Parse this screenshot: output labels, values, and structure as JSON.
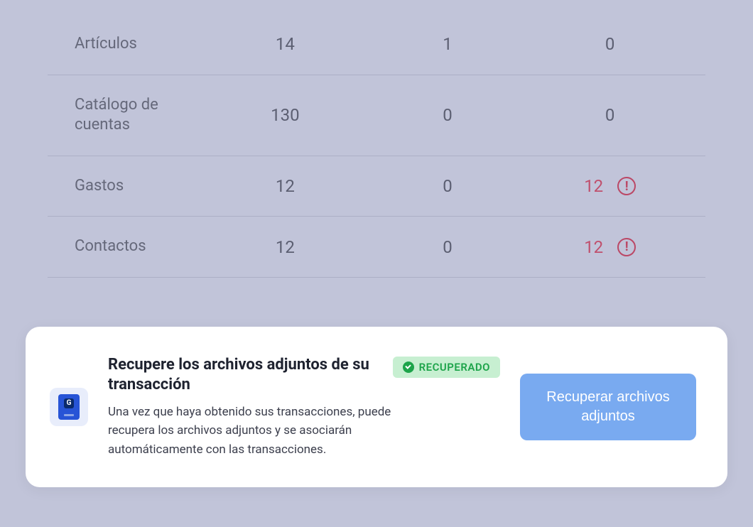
{
  "table": {
    "rows": [
      {
        "name": "Artículos",
        "col1": "14",
        "col2": "1",
        "col3": "0",
        "alert": false
      },
      {
        "name": "Catálogo de cuentas",
        "col1": "130",
        "col2": "0",
        "col3": "0",
        "alert": false
      },
      {
        "name": "Gastos",
        "col1": "12",
        "col2": "0",
        "col3": "12",
        "alert": true
      },
      {
        "name": "Contactos",
        "col1": "12",
        "col2": "0",
        "col3": "12",
        "alert": true
      }
    ]
  },
  "card": {
    "title": "Recupere los archivos adjuntos de su transacción",
    "badge": "RECUPERADO",
    "description": "Una vez que haya obtenido sus transacciones, puede recupera los archivos adjuntos y se asociarán automáticamente con las transacciones.",
    "button": "Recuperar archivos adjuntos"
  }
}
